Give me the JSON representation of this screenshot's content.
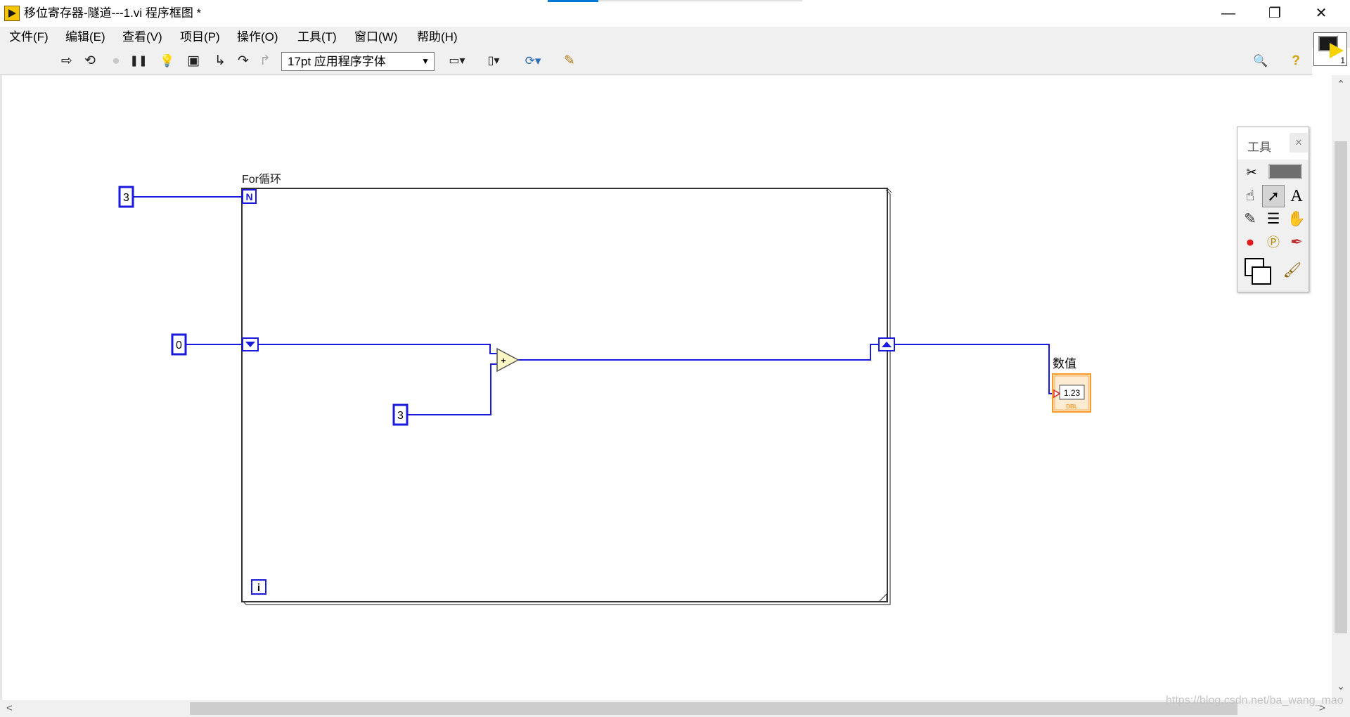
{
  "window": {
    "title": "移位寄存器-隧道---1.vi 程序框图 *",
    "minimize": "—",
    "restore": "❐",
    "close": "✕"
  },
  "menu": [
    "文件(F)",
    "编辑(E)",
    "查看(V)",
    "项目(P)",
    "操作(O)",
    "工具(T)",
    "窗口(W)",
    "帮助(H)"
  ],
  "toolbar": {
    "font": "17pt 应用程序字体",
    "font_arrow": "▼",
    "run": "⇨",
    "run_continuously": "⟲",
    "abort": "●",
    "pause": "❚❚",
    "highlight": "💡",
    "retain_wire": "▣",
    "step_into": "↳",
    "step_over": "↷",
    "step_out": "↱",
    "align": "▭▾",
    "distribute": "▯▾",
    "reorder": "⟳▾",
    "cleanup": "✎",
    "search": "🔍",
    "help": "?"
  },
  "vi_icon": {
    "number": "1"
  },
  "diagram": {
    "for_loop": {
      "label": "For循环",
      "count_terminal": "N",
      "iteration_terminal": "i"
    },
    "count_constant": "3",
    "init_constant": "0",
    "add_constant": "3",
    "add_node": "+",
    "indicator": {
      "label": "数值",
      "value": "1.23",
      "type": "DBL"
    }
  },
  "tools_palette": {
    "title": "工具",
    "close": "✕",
    "icons": [
      "auto-tool",
      "led-indicator",
      "operate",
      "position",
      "text",
      "connect-wire",
      "shortcut-menu",
      "scroll",
      "breakpoint",
      "probe",
      "color-copy",
      "set-color",
      "paintbrush"
    ]
  },
  "scrollbars": {
    "up": "⌃",
    "down": "⌄",
    "left": "<",
    "right": ">"
  },
  "watermark": "https://blog.csdn.net/ba_wang_mao",
  "colors": {
    "wire": "#1a1adf",
    "indicator": "#f59c2d",
    "node": "#fbf7c4",
    "accent": "#0078d7"
  }
}
